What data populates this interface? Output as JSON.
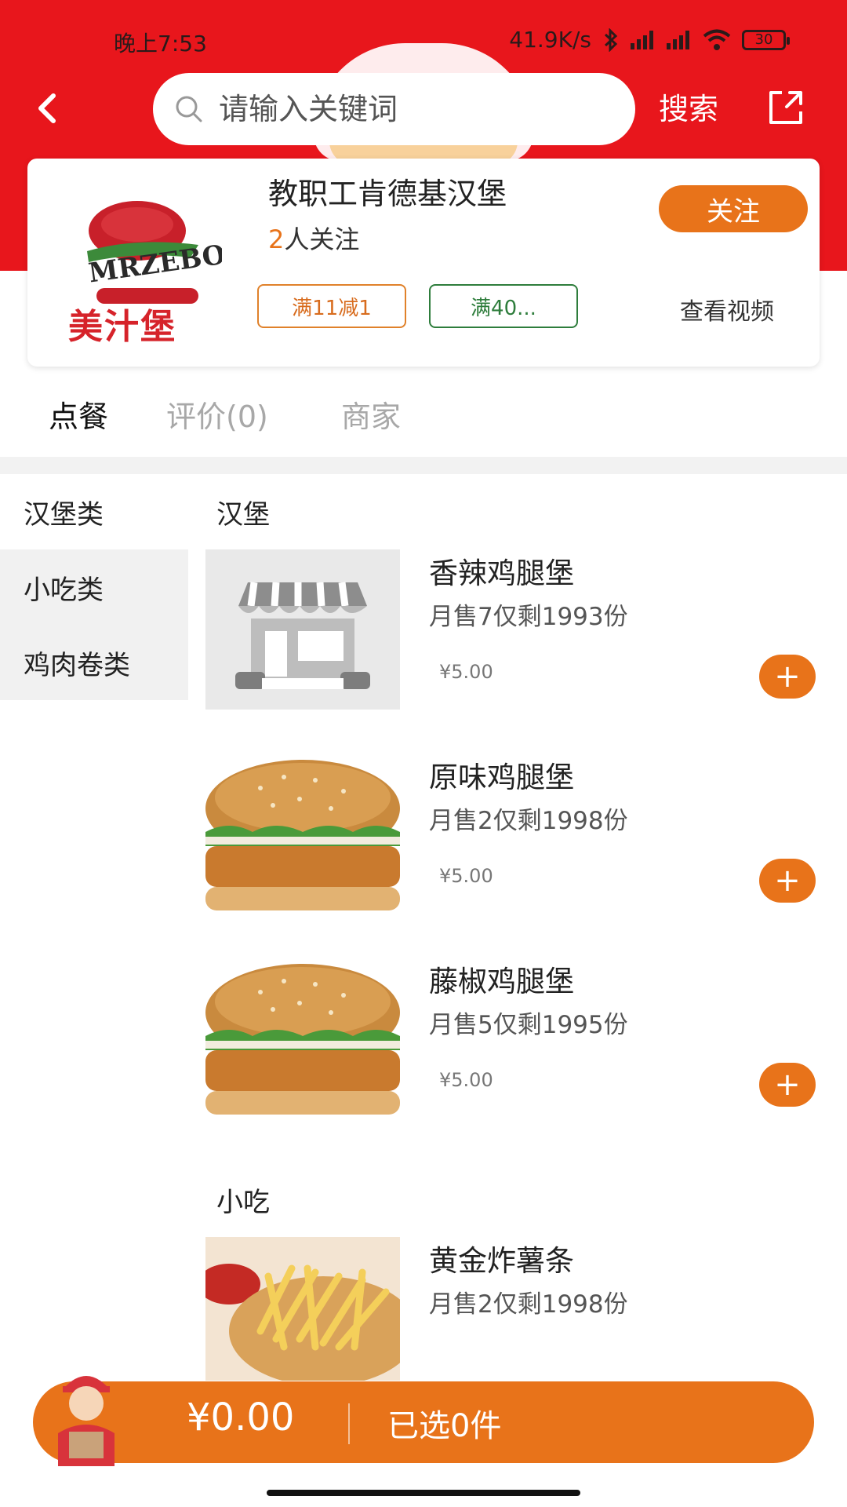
{
  "status_bar": {
    "time": "晚上7:53",
    "net_speed": "41.9K/s",
    "battery": "30"
  },
  "header": {
    "search_placeholder": "请输入关键词",
    "search_label": "搜索"
  },
  "shop": {
    "logo_text": "美汁堡",
    "name": "教职工肯德基汉堡",
    "followers_count": "2",
    "followers_suffix": "人关注",
    "follow_label": "关注",
    "coupons": [
      "满11减1",
      "满40..."
    ],
    "video_label": "查看视频"
  },
  "tabs": [
    {
      "label": "点餐"
    },
    {
      "label": "评价(0)"
    },
    {
      "label": "商家"
    }
  ],
  "categories": [
    {
      "label": "汉堡类"
    },
    {
      "label": "小吃类"
    },
    {
      "label": "鸡肉卷类"
    }
  ],
  "sections": [
    {
      "title": "汉堡",
      "items": [
        {
          "name": "香辣鸡腿堡",
          "sales": "月售7仅剩1993份",
          "price": "¥5.00",
          "image": "store-placeholder-icon"
        },
        {
          "name": "原味鸡腿堡",
          "sales": "月售2仅剩1998份",
          "price": "¥5.00",
          "image": "burger-photo"
        },
        {
          "name": "藤椒鸡腿堡",
          "sales": "月售5仅剩1995份",
          "price": "¥5.00",
          "image": "burger-photo"
        }
      ]
    },
    {
      "title": "小吃",
      "items": [
        {
          "name": "黄金炸薯条",
          "sales": "月售2仅剩1998份",
          "price": "",
          "image": "fries-photo"
        }
      ]
    }
  ],
  "cart": {
    "total": "¥0.00",
    "count_label": "已选0件"
  },
  "colors": {
    "header_red": "#e8161c",
    "accent_orange": "#e8731a",
    "coupon_green": "#2e7d3c"
  }
}
